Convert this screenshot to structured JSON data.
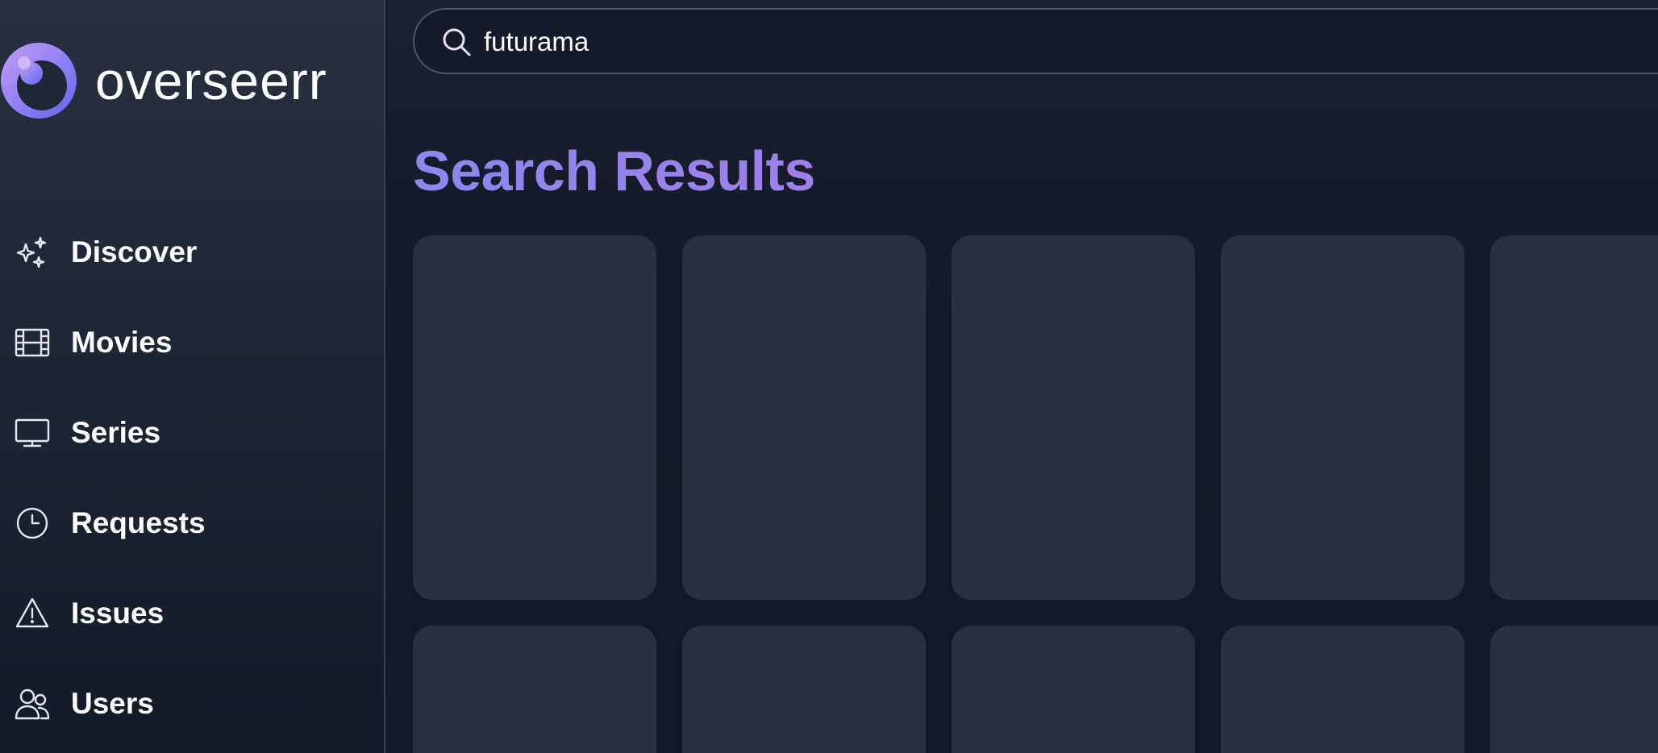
{
  "app": {
    "logo_text": "overseerr",
    "brand_color": "#8b88ee"
  },
  "sidebar": {
    "items": [
      {
        "label": "Discover",
        "icon": "sparkles-icon"
      },
      {
        "label": "Movies",
        "icon": "film-icon"
      },
      {
        "label": "Series",
        "icon": "tv-icon"
      },
      {
        "label": "Requests",
        "icon": "clock-icon"
      },
      {
        "label": "Issues",
        "icon": "warning-icon"
      },
      {
        "label": "Users",
        "icon": "users-icon"
      }
    ]
  },
  "search": {
    "value": "futurama",
    "icon": "search-icon"
  },
  "main": {
    "title": "Search Results",
    "placeholder_card_count": 10
  }
}
